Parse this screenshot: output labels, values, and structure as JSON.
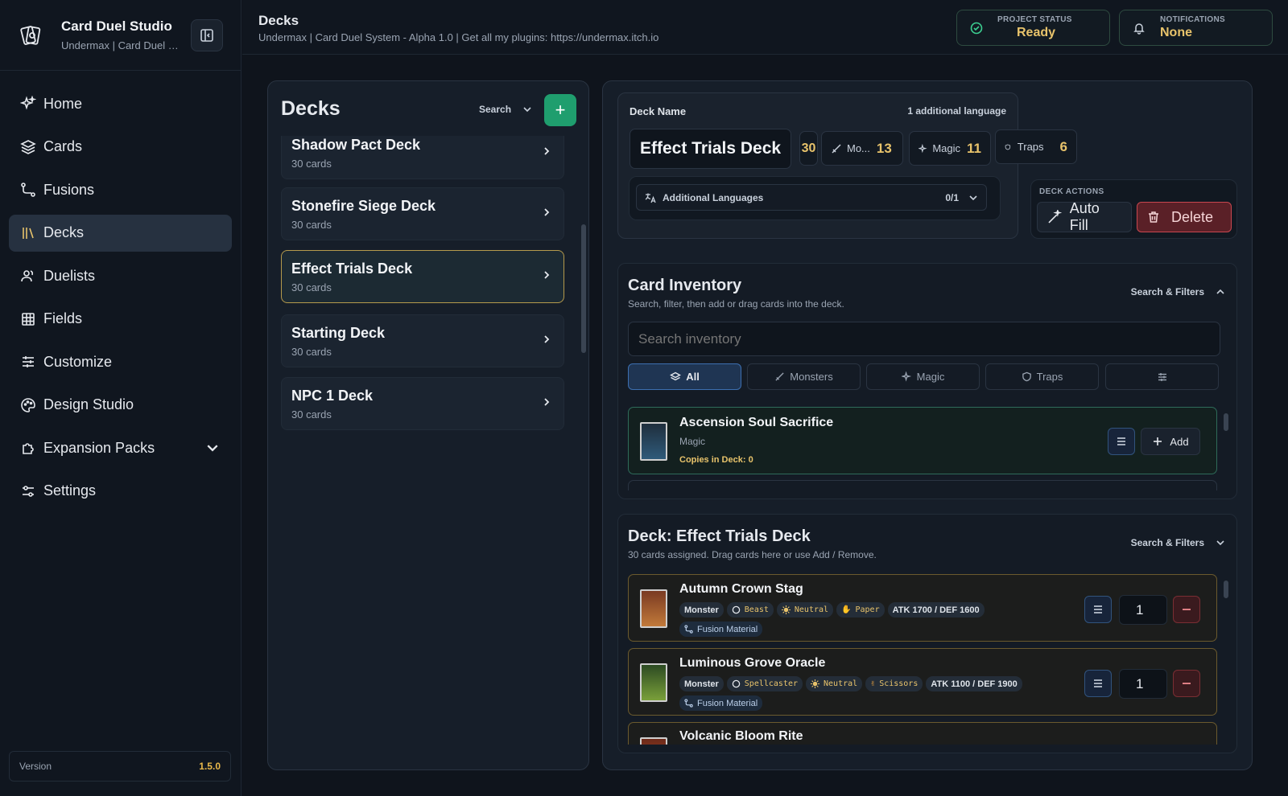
{
  "app": {
    "title": "Card Duel Studio",
    "subtitle": "Undermax | Card Duel S..."
  },
  "nav": {
    "items": [
      {
        "label": "Home",
        "icon": "sparkle-icon"
      },
      {
        "label": "Cards",
        "icon": "layers-icon"
      },
      {
        "label": "Fusions",
        "icon": "route-icon"
      },
      {
        "label": "Decks",
        "icon": "library-icon",
        "active": true
      },
      {
        "label": "Duelists",
        "icon": "users-icon"
      },
      {
        "label": "Fields",
        "icon": "grid-icon"
      },
      {
        "label": "Customize",
        "icon": "sliders-icon"
      },
      {
        "label": "Design Studio",
        "icon": "palette-icon"
      },
      {
        "label": "Expansion Packs",
        "icon": "puzzle-icon"
      },
      {
        "label": "Settings",
        "icon": "settings-icon"
      }
    ]
  },
  "version": {
    "label": "Version",
    "value": "1.5.0"
  },
  "header": {
    "title": "Decks",
    "subtitle": "Undermax | Card Duel System - Alpha 1.0 | Get all my plugins: https://undermax.itch.io",
    "project_status_label": "PROJECT STATUS",
    "project_status_value": "Ready",
    "notifications_label": "NOTIFICATIONS",
    "notifications_value": "None"
  },
  "deck_list": {
    "title": "Decks",
    "search_label": "Search",
    "add_label": "+",
    "items": [
      {
        "name": "Shadow Pact Deck",
        "count": "30 cards"
      },
      {
        "name": "Stonefire Siege Deck",
        "count": "30 cards"
      },
      {
        "name": "Effect Trials Deck",
        "count": "30 cards"
      },
      {
        "name": "Starting Deck",
        "count": "30 cards"
      },
      {
        "name": "NPC 1 Deck",
        "count": "30 cards"
      }
    ]
  },
  "deck_editor": {
    "name_label": "Deck Name",
    "additional_language_note": "1 additional language",
    "name_value": "Effect Trials Deck",
    "total": "30",
    "monsters_label": "Mo...",
    "monsters_value": "13",
    "magic_label": "Magic",
    "magic_value": "11",
    "traps_label": "Traps",
    "traps_value": "6",
    "additional_languages_label": "Additional Languages",
    "additional_languages_count": "0/1",
    "actions_label": "DECK ACTIONS",
    "autofill_label": "Auto Fill",
    "delete_label": "Delete"
  },
  "inventory": {
    "title": "Card Inventory",
    "subtitle": "Search, filter, then add or drag cards into the deck.",
    "filters_label": "Search & Filters",
    "search_placeholder": "Search inventory",
    "tabs": [
      {
        "label": "All",
        "icon": "layers-icon"
      },
      {
        "label": "Monsters",
        "icon": "sword-icon"
      },
      {
        "label": "Magic",
        "icon": "sparkle-icon"
      },
      {
        "label": "Traps",
        "icon": "shield-icon"
      },
      {
        "label": "",
        "icon": "sliders-icon"
      }
    ],
    "cards": [
      {
        "name": "Ascension Soul Sacrifice",
        "type": "Magic",
        "copies": "Copies in Deck: 0",
        "add_label": "Add"
      }
    ]
  },
  "deck_cards": {
    "title": "Deck: Effect Trials Deck",
    "subtitle": "30 cards assigned. Drag cards here or use Add / Remove.",
    "filters_label": "Search & Filters",
    "cards": [
      {
        "name": "Autumn Crown Stag",
        "kind": "Monster",
        "race": "Beast",
        "attr": "Neutral",
        "hand": "Paper",
        "stats": "ATK 1700 / DEF 1600",
        "fusion": "Fusion Material",
        "qty": "1"
      },
      {
        "name": "Luminous Grove Oracle",
        "kind": "Monster",
        "race": "Spellcaster",
        "attr": "Neutral",
        "hand": "Scissors",
        "stats": "ATK 1100 / DEF 1900",
        "fusion": "Fusion Material",
        "qty": "1"
      },
      {
        "name": "Volcanic Bloom Rite"
      }
    ]
  },
  "colors": {
    "accent_green": "#1f9e6e",
    "gold": "#e8c36b",
    "delete_red": "#c9474f",
    "selection": "#b59a4c"
  }
}
